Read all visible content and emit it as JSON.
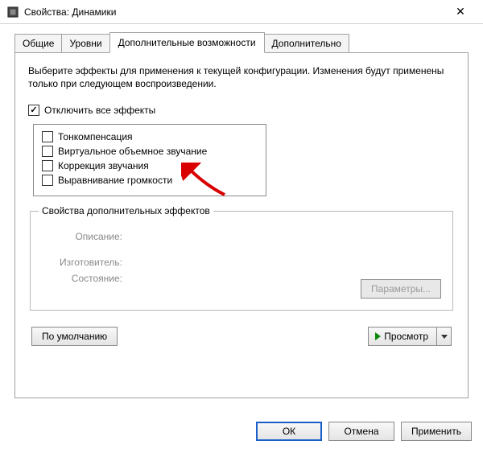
{
  "window": {
    "title": "Свойства: Динамики"
  },
  "tabs": {
    "general": "Общие",
    "levels": "Уровни",
    "enhancements": "Дополнительные возможности",
    "advanced": "Дополнительно"
  },
  "panel": {
    "description": "Выберите эффекты для применения к текущей конфигурации. Изменения будут применены только при следующем воспроизведении.",
    "disable_all_label": "Отключить все эффекты",
    "effects": [
      "Тонкомпенсация",
      "Виртуальное объемное звучание",
      "Коррекция звучания",
      "Выравнивание громкости"
    ],
    "props_group_title": "Свойства дополнительных эффектов",
    "desc_label": "Описание:",
    "vendor_label": "Изготовитель:",
    "state_label": "Состояние:",
    "params_btn": "Параметры...",
    "defaults_btn": "По умолчанию",
    "preview_btn": "Просмотр"
  },
  "footer": {
    "ok": "ОК",
    "cancel": "Отмена",
    "apply": "Применить"
  }
}
